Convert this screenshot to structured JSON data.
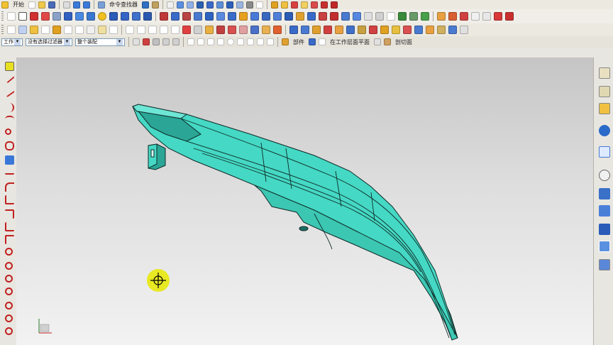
{
  "toolbar1": {
    "start_menu_label": "开始",
    "command_finder_label": "命令查找器"
  },
  "toolbar3": {
    "selection_filter": "没有选择过滤器",
    "selection_scope": "整个装配",
    "work_layer_label": "工作",
    "snap_point_label": "部件",
    "workplane_label": "在工作层面平面",
    "stop_at_label": "剖切面"
  },
  "colors": {
    "part_fill": "#45d8c4",
    "part_shade": "#2aa596",
    "part_edge": "#0d2a26",
    "cursor_highlight": "#e8e800"
  },
  "icons": {
    "left_sketch_tools": [
      "sketch-icon",
      "line-icon",
      "profile-icon",
      "arc-icon",
      "spline-icon",
      "point-icon",
      "offset-icon",
      "mirror-icon",
      "derived-line-icon",
      "fillet-icon",
      "chamfer-icon",
      "trim-icon",
      "extend-icon",
      "make-corner-icon",
      "circle-icon",
      "ellipse-icon",
      "conic-icon",
      "polygon-icon",
      "constraint-icon",
      "dimension-icon",
      "coordinate-icon"
    ],
    "right_resource_bar": [
      "assembly-navigator-icon",
      "part-navigator-icon",
      "reuse-library-icon",
      "roles-icon",
      "web-browser-icon",
      "history-icon",
      "system-materials-icon",
      "process-studio-icon",
      "manufacturing-wizard-icon",
      "palette-icon"
    ]
  }
}
